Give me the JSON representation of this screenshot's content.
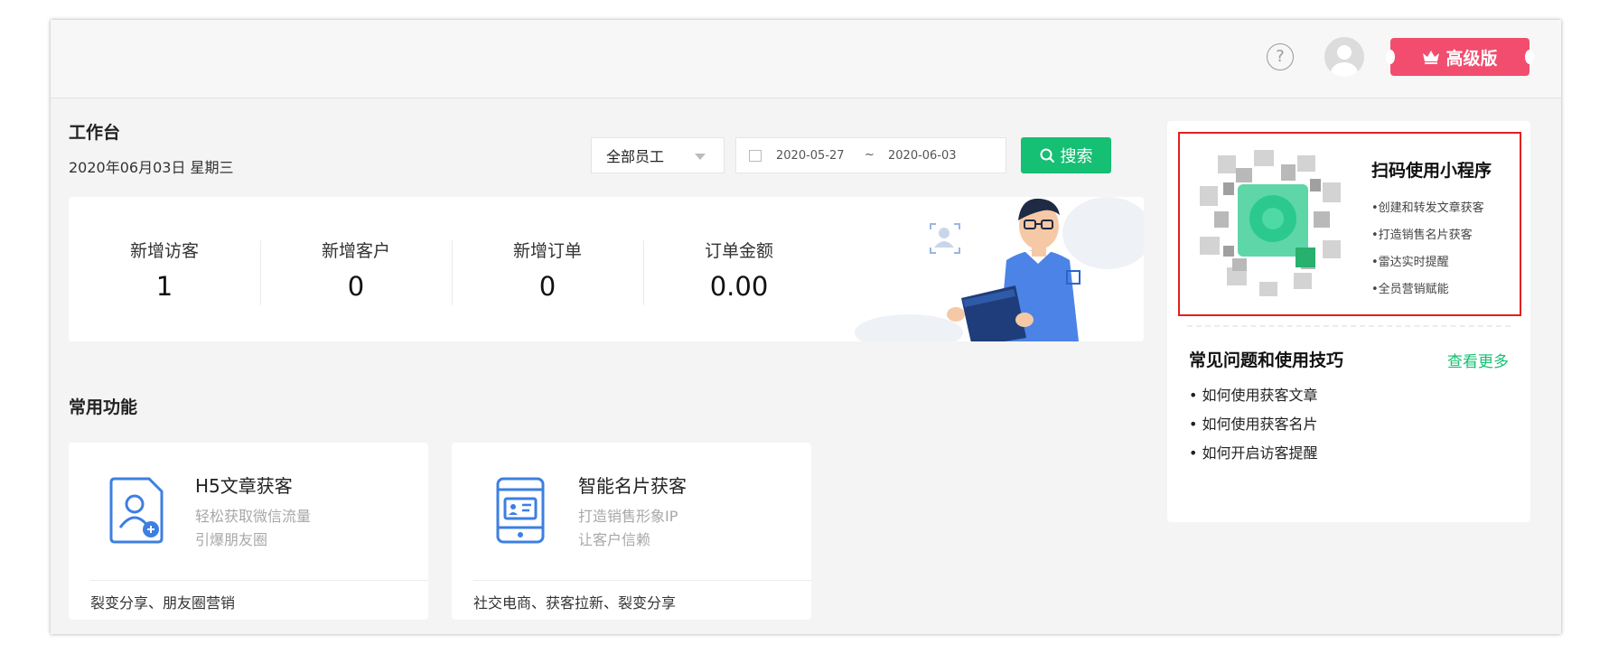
{
  "header": {
    "help_icon": "?",
    "premium_label": "高级版",
    "colors": {
      "premium": "#f24d6e",
      "accent": "#15bf73"
    }
  },
  "workspace": {
    "title": "工作台",
    "date": "2020年06月03日 星期三",
    "filter": {
      "staff_selected": "全部员工",
      "date_from": "2020-05-27",
      "date_sep": "~",
      "date_to": "2020-06-03"
    },
    "search_label": "搜索"
  },
  "stats": [
    {
      "label": "新增访客",
      "value": "1"
    },
    {
      "label": "新增客户",
      "value": "0"
    },
    {
      "label": "新增订单",
      "value": "0"
    },
    {
      "label": "订单金额",
      "value": "0.00"
    }
  ],
  "common": {
    "title": "常用功能",
    "cards": [
      {
        "icon": "user-card-icon",
        "title": "H5文章获客",
        "line1": "轻松获取微信流量",
        "line2": "引爆朋友圈",
        "tags": "裂变分享、朋友圈营销"
      },
      {
        "icon": "phone-card-icon",
        "title": "智能名片获客",
        "line1": "打造销售形象IP",
        "line2": "让客户信赖",
        "tags": "社交电商、获客拉新、裂变分享"
      }
    ]
  },
  "sidebar": {
    "qr_title": "扫码使用小程序",
    "qr_features": [
      "•创建和转发文章获客",
      "•打造销售名片获客",
      "•雷达实时提醒",
      "•全员营销赋能"
    ],
    "faq_title": "常见问题和使用技巧",
    "faq_more": "查看更多",
    "faq_items": [
      "• 如何使用获客文章",
      "• 如何使用获客名片",
      "• 如何开启访客提醒"
    ]
  }
}
